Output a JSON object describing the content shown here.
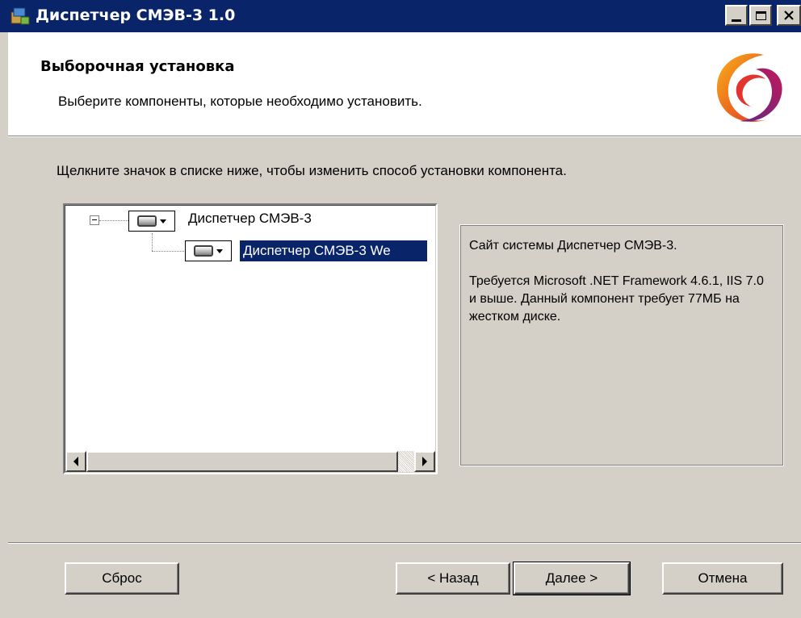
{
  "window": {
    "title": "Диспетчер СМЭВ-3 1.0",
    "app_icon": "installer-icon",
    "controls": [
      "minimize-icon",
      "maximize-icon",
      "close-icon"
    ]
  },
  "header": {
    "title": "Выборочная установка",
    "subtitle": "Выберите компоненты, которые необходимо установить.",
    "logo": "smev-logo"
  },
  "instruction": "Щелкните значок в списке ниже, чтобы изменить способ установки компонента.",
  "tree": {
    "items": [
      {
        "label": "Диспетчер СМЭВ-3",
        "icon": "hard-disk-icon",
        "expanded": true
      },
      {
        "label": "Диспетчер СМЭВ-3 We",
        "icon": "hard-disk-icon",
        "selected": true
      }
    ]
  },
  "description": {
    "p1": "Сайт системы Диспетчер СМЭВ-3.",
    "p2": "Требуется Microsoft .NET Framework 4.6.1, IIS 7.0 и выше. Данный компонент требует 77МБ на жестком диске."
  },
  "buttons": {
    "reset": "Сброс",
    "back": "< Назад",
    "next": "Далее >",
    "cancel": "Отмена"
  },
  "colors": {
    "titlebar": "#0a246a",
    "selection": "#0a246a",
    "face": "#d4d0c8",
    "logo_orange": "#f39200",
    "logo_red": "#e3342f",
    "logo_purple": "#5b2a86"
  }
}
